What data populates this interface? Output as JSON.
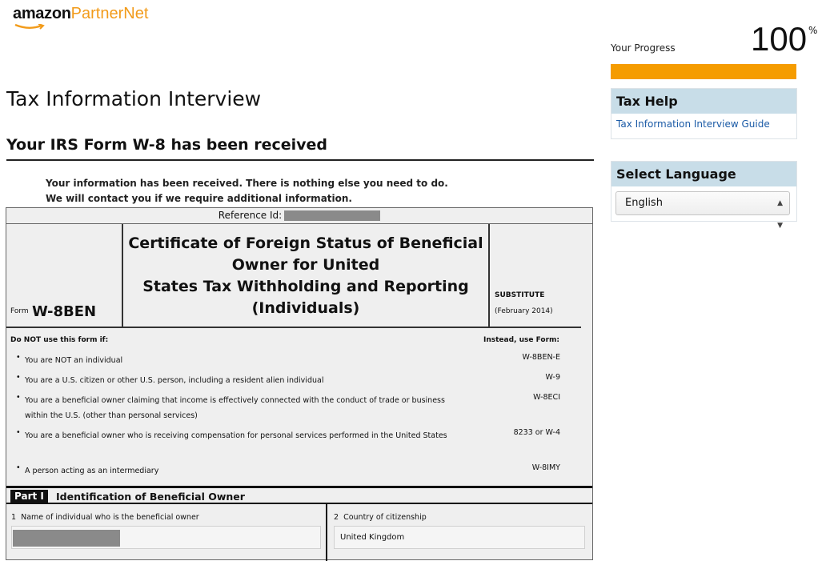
{
  "logo": {
    "brand": "amazon",
    "product": "PartnerNet"
  },
  "progress": {
    "label": "Your Progress",
    "value": "100",
    "unit": "%",
    "fraction": 1.0,
    "color": "#f59c00"
  },
  "tax_help": {
    "title": "Tax Help",
    "link": "Tax Information Interview Guide"
  },
  "language": {
    "title": "Select Language",
    "selected": "English"
  },
  "page": {
    "title": "Tax Information Interview",
    "subtitle": "Your IRS Form W-8 has been received",
    "message_line1": "Your information has been received. There is nothing else you need to do.",
    "message_line2": "We will contact you if we require additional information."
  },
  "form": {
    "reference_label": "Reference Id:",
    "form_label": "Form",
    "form_number": "W-8BEN",
    "title_lines": [
      "Certificate of Foreign Status of Beneficial",
      "Owner for United",
      "States Tax Withholding and Reporting",
      "(Individuals)"
    ],
    "substitute": "SUBSTITUTE",
    "date": "(February 2014)",
    "do_not_use": "Do NOT use this form if:",
    "instead_use": "Instead, use Form:",
    "conditions": [
      {
        "text": "You are NOT an individual",
        "form": "W-8BEN-E"
      },
      {
        "text": "You are a U.S. citizen or other U.S. person, including a resident alien individual",
        "form": "W-9"
      },
      {
        "text": "You are a beneficial owner claiming that income is effectively connected with the conduct of trade or business within the U.S. (other than personal services)",
        "form": "W-8ECI"
      },
      {
        "text": "You are a beneficial owner who is receiving compensation for personal services performed in the United States",
        "form": "8233 or W-4"
      },
      {
        "text": "A person acting as an intermediary",
        "form": "W-8IMY"
      }
    ],
    "part_label": "Part I",
    "part_title": "Identification of Beneficial Owner",
    "field1_number": "1",
    "field1_label": "Name of individual who is the beneficial owner",
    "field2_number": "2",
    "field2_label": "Country of citizenship",
    "field2_value": "United Kingdom"
  }
}
